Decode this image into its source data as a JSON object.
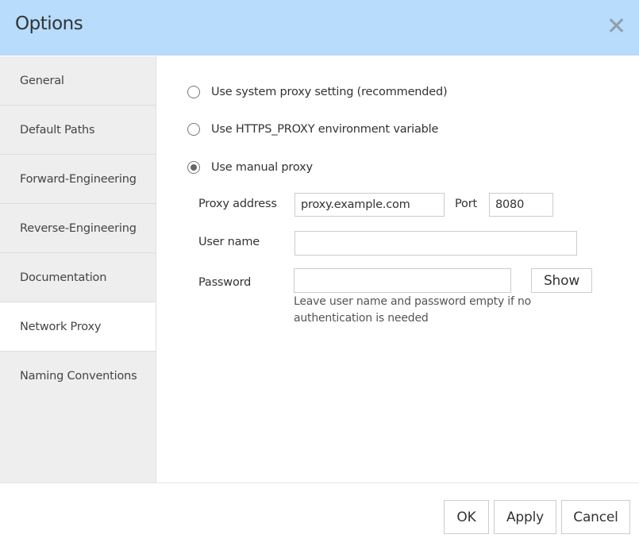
{
  "dialog": {
    "title": "Options",
    "close_icon": "close-icon"
  },
  "sidebar": {
    "items": [
      {
        "label": "General",
        "active": false
      },
      {
        "label": "Default Paths",
        "active": false
      },
      {
        "label": "Forward-Engineering",
        "active": false
      },
      {
        "label": "Reverse-Engineering",
        "active": false
      },
      {
        "label": "Documentation",
        "active": false
      },
      {
        "label": "Network Proxy",
        "active": true
      },
      {
        "label": "Naming Conventions",
        "active": false
      }
    ]
  },
  "proxy": {
    "options": [
      {
        "label": "Use system proxy setting (recommended)",
        "checked": false
      },
      {
        "label": "Use HTTPS_PROXY environment variable",
        "checked": false
      },
      {
        "label": "Use manual proxy",
        "checked": true
      }
    ],
    "address_label": "Proxy address",
    "address_value": "proxy.example.com",
    "port_label": "Port",
    "port_value": "8080",
    "username_label": "User name",
    "username_value": "",
    "password_label": "Password",
    "password_value": "",
    "show_label": "Show",
    "hint": "Leave user name and password empty if no authentication is needed"
  },
  "footer": {
    "ok_label": "OK",
    "apply_label": "Apply",
    "cancel_label": "Cancel"
  }
}
